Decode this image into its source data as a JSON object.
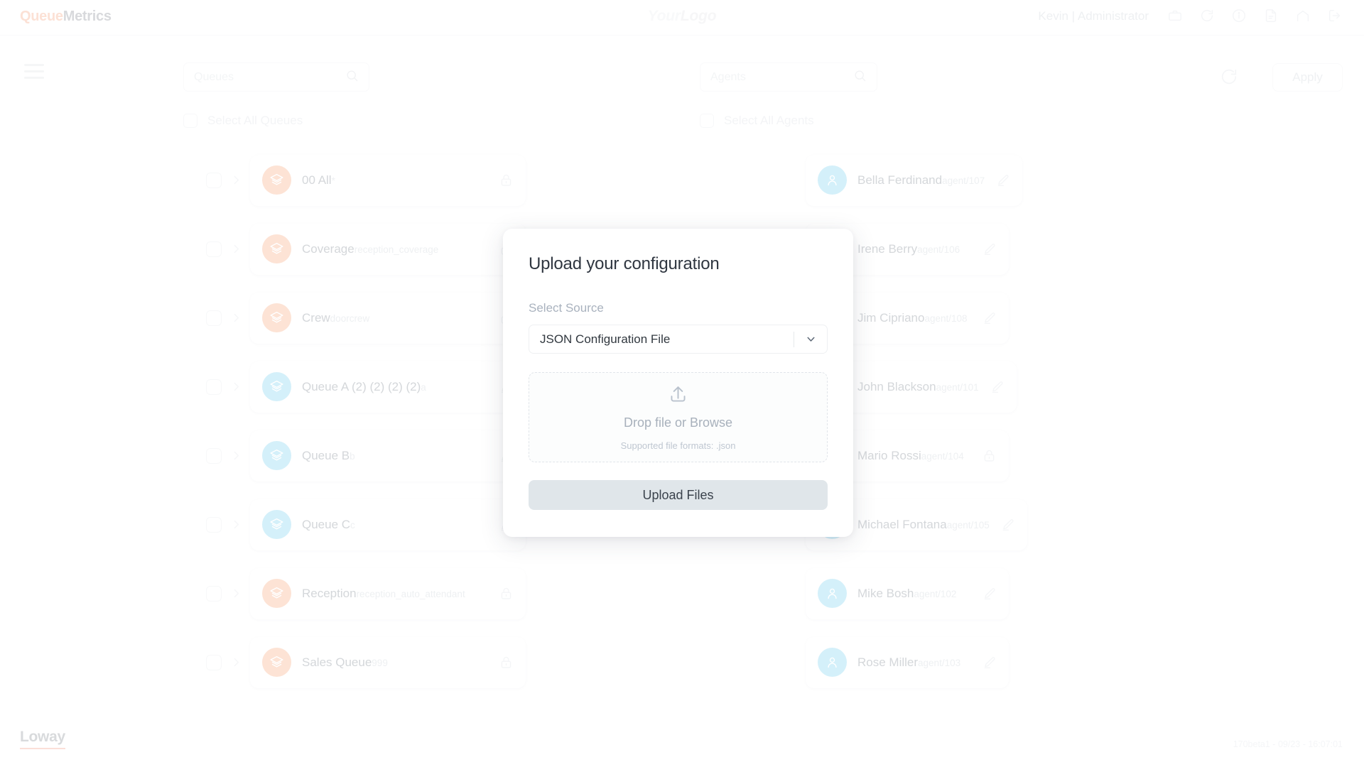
{
  "header": {
    "brand_prefix": "Queue",
    "brand_suffix": "Metrics",
    "center_logo_first": "Your",
    "center_logo_second": "Logo",
    "user": "Kevin | Administrator",
    "icons": [
      "briefcase-icon",
      "refresh-icon",
      "info-icon",
      "document-icon",
      "home-icon",
      "logout-icon"
    ]
  },
  "toolbar": {
    "menu_icon": "hamburger-icon",
    "queues_search_placeholder": "Queues",
    "agents_search_placeholder": "Agents",
    "queues_search_value": "",
    "agents_search_value": "",
    "refresh_icon": "refresh-icon",
    "apply_label": "Apply"
  },
  "queues_panel": {
    "select_all_label": "Select All Queues",
    "select_all_checked": false,
    "items": [
      {
        "name": "00 All",
        "sub": "*",
        "color": "orange",
        "action": "lock-icon",
        "checked": false
      },
      {
        "name": "Coverage",
        "sub": "reception_coverage",
        "color": "orange",
        "action": "lock-icon",
        "checked": false
      },
      {
        "name": "Crew",
        "sub": "doorcrew",
        "color": "orange",
        "action": "lock-icon",
        "checked": false
      },
      {
        "name": "Queue A (2) (2) (2) (2)",
        "sub": "a",
        "color": "blue",
        "action": "edit-icon",
        "checked": false
      },
      {
        "name": "Queue B",
        "sub": "b",
        "color": "blue",
        "action": "edit-icon",
        "checked": false
      },
      {
        "name": "Queue C",
        "sub": "c",
        "color": "blue",
        "action": "edit-icon",
        "checked": false
      },
      {
        "name": "Reception",
        "sub": "reception_auto_attendant",
        "color": "orange",
        "action": "lock-icon",
        "checked": false
      },
      {
        "name": "Sales Queue",
        "sub": "999",
        "color": "orange",
        "action": "lock-icon",
        "checked": false
      }
    ]
  },
  "agents_panel": {
    "select_all_label": "Select All Agents",
    "select_all_checked": false,
    "items": [
      {
        "name": "Bella Ferdinand",
        "sub": "agent/107",
        "action": "edit-icon",
        "checked": false
      },
      {
        "name": "Irene Berry",
        "sub": "agent/106",
        "action": "edit-icon",
        "checked": false
      },
      {
        "name": "Jim Cipriano",
        "sub": "agent/108",
        "action": "edit-icon",
        "checked": false
      },
      {
        "name": "John Blackson",
        "sub": "agent/101",
        "action": "edit-icon",
        "checked": false
      },
      {
        "name": "Mario Rossi",
        "sub": "agent/104",
        "action": "lock-icon",
        "checked": false
      },
      {
        "name": "Michael Fontana",
        "sub": "agent/105",
        "action": "edit-icon",
        "checked": false
      },
      {
        "name": "Mike Bosh",
        "sub": "agent/102",
        "action": "edit-icon",
        "checked": false
      },
      {
        "name": "Rose Miller",
        "sub": "agent/103",
        "action": "edit-icon",
        "checked": false
      }
    ]
  },
  "modal": {
    "title": "Upload your configuration",
    "source_label": "Select Source",
    "source_value": "JSON Configuration File",
    "source_options": [
      "JSON Configuration File"
    ],
    "dropzone_icon": "upload-icon",
    "dropzone_title": "Drop file or Browse",
    "dropzone_subtitle": "Supported file formats: .json",
    "upload_label": "Upload Files"
  },
  "footer": {
    "logo": "Loway",
    "version": "170beta1 - 09/23 - 16:07:01"
  },
  "colors": {
    "brand_orange": "#f7a583",
    "queue_orange": "#f9ab81",
    "queue_blue": "#7fd4f0",
    "loway_underline": "#f4a08a"
  }
}
